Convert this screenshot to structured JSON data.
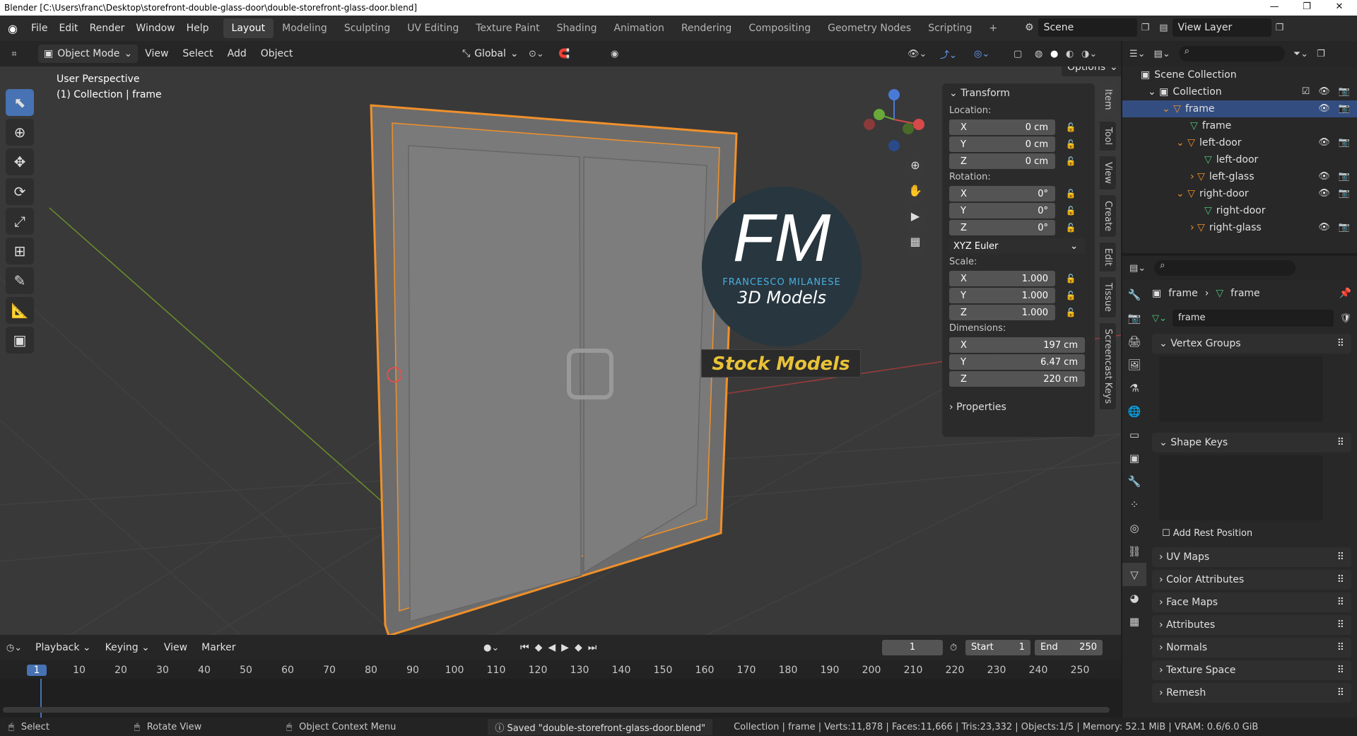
{
  "window": {
    "title": "Blender [C:\\Users\\franc\\Desktop\\storefront-double-glass-door\\double-storefront-glass-door.blend]"
  },
  "menu": [
    "File",
    "Edit",
    "Render",
    "Window",
    "Help"
  ],
  "workspaces": [
    "Layout",
    "Modeling",
    "Sculpting",
    "UV Editing",
    "Texture Paint",
    "Shading",
    "Animation",
    "Rendering",
    "Compositing",
    "Geometry Nodes",
    "Scripting"
  ],
  "active_workspace": "Layout",
  "scene": {
    "name": "Scene",
    "view_layer": "View Layer"
  },
  "header3d": {
    "mode": "Object Mode",
    "view": "View",
    "select": "Select",
    "add": "Add",
    "object": "Object",
    "transform_orientation": "Global",
    "options": "Options"
  },
  "viewport": {
    "perspective": "User Perspective",
    "collection_info": "(1) Collection | frame"
  },
  "watermark": {
    "logo": "FM",
    "brand": "FRANCESCO MILANESE",
    "tagline": "3D Models",
    "banner": "Stock Models"
  },
  "npanel": {
    "title": "Transform",
    "location_label": "Location:",
    "location": [
      {
        "axis": "X",
        "value": "0 cm"
      },
      {
        "axis": "Y",
        "value": "0 cm"
      },
      {
        "axis": "Z",
        "value": "0 cm"
      }
    ],
    "rotation_label": "Rotation:",
    "rotation": [
      {
        "axis": "X",
        "value": "0°"
      },
      {
        "axis": "Y",
        "value": "0°"
      },
      {
        "axis": "Z",
        "value": "0°"
      }
    ],
    "rotation_mode": "XYZ Euler",
    "scale_label": "Scale:",
    "scale": [
      {
        "axis": "X",
        "value": "1.000"
      },
      {
        "axis": "Y",
        "value": "1.000"
      },
      {
        "axis": "Z",
        "value": "1.000"
      }
    ],
    "dimensions_label": "Dimensions:",
    "dimensions": [
      {
        "axis": "X",
        "value": "197 cm"
      },
      {
        "axis": "Y",
        "value": "6.47 cm"
      },
      {
        "axis": "Z",
        "value": "220 cm"
      }
    ],
    "properties": "Properties",
    "side_tabs": [
      "Item",
      "Tool",
      "View",
      "Create",
      "Edit",
      "Tissue",
      "Screencast Keys"
    ]
  },
  "outliner": {
    "root": "Scene Collection",
    "items": [
      {
        "label": "Collection",
        "depth": 1
      },
      {
        "label": "frame",
        "depth": 2,
        "selected": true
      },
      {
        "label": "frame",
        "depth": 3
      },
      {
        "label": "left-door",
        "depth": 2
      },
      {
        "label": "left-door",
        "depth": 3
      },
      {
        "label": "left-glass",
        "depth": 3
      },
      {
        "label": "right-door",
        "depth": 2
      },
      {
        "label": "right-door",
        "depth": 3
      },
      {
        "label": "right-glass",
        "depth": 3
      }
    ]
  },
  "properties": {
    "breadcrumb_object": "frame",
    "breadcrumb_data": "frame",
    "data_name": "frame",
    "sections": [
      "Vertex Groups",
      "Shape Keys",
      "UV Maps",
      "Color Attributes",
      "Face Maps",
      "Attributes",
      "Normals",
      "Texture Space",
      "Remesh"
    ],
    "add_rest_position": "Add Rest Position"
  },
  "timeline": {
    "menus": [
      "Playback",
      "Keying",
      "View",
      "Marker"
    ],
    "current_frame": "1",
    "start_label": "Start",
    "start": "1",
    "end_label": "End",
    "end": "250",
    "ticks": [
      "1",
      "10",
      "20",
      "30",
      "40",
      "50",
      "60",
      "70",
      "80",
      "90",
      "100",
      "110",
      "120",
      "130",
      "140",
      "150",
      "160",
      "170",
      "180",
      "190",
      "200",
      "210",
      "220",
      "230",
      "240",
      "250"
    ]
  },
  "status": {
    "select": "Select",
    "rotate": "Rotate View",
    "context": "Object Context Menu",
    "message": "Saved \"double-storefront-glass-door.blend\"",
    "stats": "Collection | frame | Verts:11,878 | Faces:11,666 | Tris:23,332 | Objects:1/5 | Memory: 52.1 MiB | VRAM: 0.6/6.0 GiB"
  }
}
